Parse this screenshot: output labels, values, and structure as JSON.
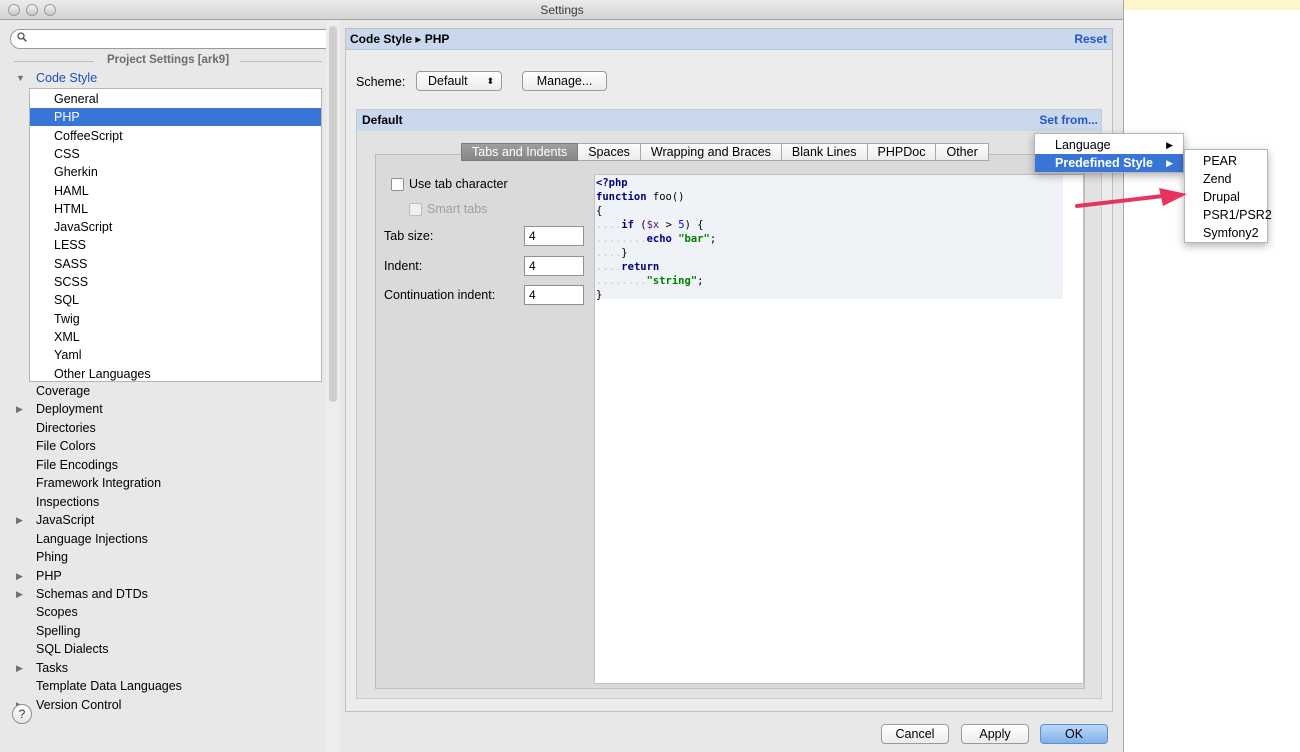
{
  "window": {
    "title": "Settings"
  },
  "search": {
    "placeholder": ""
  },
  "project_settings_header": "Project Settings [ark9]",
  "tree": {
    "code_style": "Code Style",
    "code_style_children": [
      "General",
      "PHP",
      "CoffeeScript",
      "CSS",
      "Gherkin",
      "HAML",
      "HTML",
      "JavaScript",
      "LESS",
      "SASS",
      "SCSS",
      "SQL",
      "Twig",
      "XML",
      "Yaml",
      "Other Languages"
    ],
    "selected_child": "PHP",
    "items": [
      {
        "label": "Coverage",
        "expandable": false
      },
      {
        "label": "Deployment",
        "expandable": true
      },
      {
        "label": "Directories",
        "expandable": false
      },
      {
        "label": "File Colors",
        "expandable": false
      },
      {
        "label": "File Encodings",
        "expandable": false
      },
      {
        "label": "Framework Integration",
        "expandable": false
      },
      {
        "label": "Inspections",
        "expandable": false
      },
      {
        "label": "JavaScript",
        "expandable": true
      },
      {
        "label": "Language Injections",
        "expandable": false
      },
      {
        "label": "Phing",
        "expandable": false
      },
      {
        "label": "PHP",
        "expandable": true
      },
      {
        "label": "Schemas and DTDs",
        "expandable": true
      },
      {
        "label": "Scopes",
        "expandable": false
      },
      {
        "label": "Spelling",
        "expandable": false
      },
      {
        "label": "SQL Dialects",
        "expandable": false
      },
      {
        "label": "Tasks",
        "expandable": true
      },
      {
        "label": "Template Data Languages",
        "expandable": false
      },
      {
        "label": "Version Control",
        "expandable": true
      }
    ]
  },
  "breadcrumb": {
    "label": "Code Style ▸ PHP",
    "reset": "Reset"
  },
  "scheme": {
    "label": "Scheme:",
    "value": "Default",
    "manage": "Manage..."
  },
  "default_panel": {
    "title": "Default",
    "set_from": "Set from..."
  },
  "tabs": [
    "Tabs and Indents",
    "Spaces",
    "Wrapping and Braces",
    "Blank Lines",
    "PHPDoc",
    "Other"
  ],
  "active_tab": "Tabs and Indents",
  "options": {
    "use_tab_character": "Use tab character",
    "smart_tabs": "Smart tabs",
    "tab_size_label": "Tab size:",
    "tab_size": "4",
    "indent_label": "Indent:",
    "indent": "4",
    "continuation_indent_label": "Continuation indent:",
    "continuation_indent": "4"
  },
  "code_preview": {
    "line1": "<?php",
    "line2_kw": "function",
    "line2_rest": " foo()",
    "line3": "{",
    "line4_kw": "if",
    "line4_a": " (",
    "line4_var": "$x",
    "line4_b": " > ",
    "line4_num": "5",
    "line4_c": ") {",
    "line5_kw": "echo",
    "line5_str": "\"bar\"",
    "line5_end": ";",
    "line6": "}",
    "line7_kw": "return",
    "line8_str": "\"string\"",
    "line8_end": ";",
    "line9": "}"
  },
  "menu": {
    "items": [
      "Language",
      "Predefined Style"
    ],
    "selected": "Predefined Style",
    "submenu": [
      "PEAR",
      "Zend",
      "Drupal",
      "PSR1/PSR2",
      "Symfony2"
    ]
  },
  "buttons": {
    "cancel": "Cancel",
    "apply": "Apply",
    "ok": "OK",
    "help": "?"
  },
  "colors": {
    "selection": "#3875d7",
    "link": "#2455c8",
    "header_bg": "#c9d8ec",
    "annotation_arrow": "#e8335e"
  }
}
